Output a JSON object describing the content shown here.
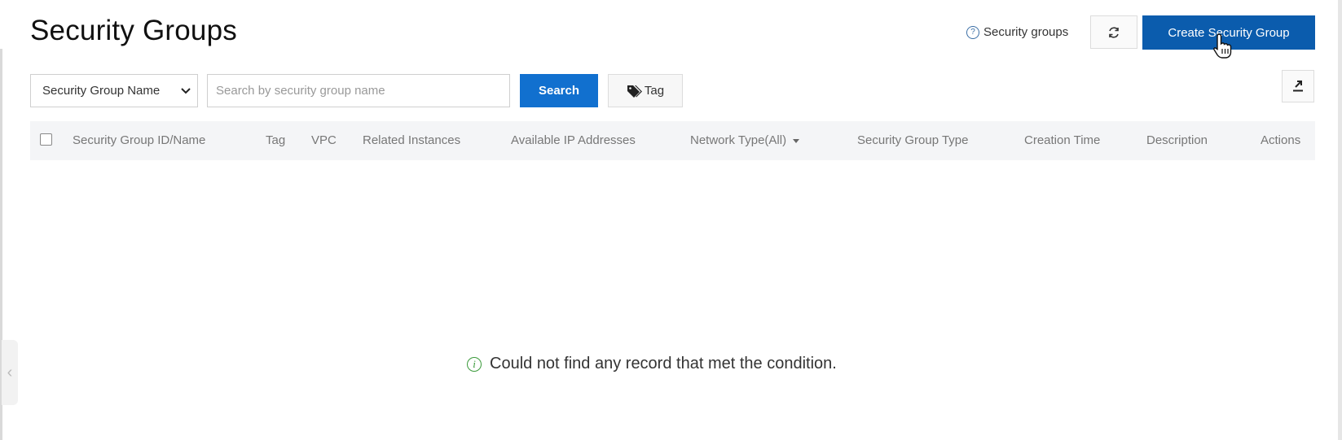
{
  "page": {
    "title": "Security Groups"
  },
  "header": {
    "help_link_label": "Security groups",
    "create_button_label": "Create Security Group"
  },
  "toolbar": {
    "filter_select_value": "Security Group Name",
    "search_placeholder": "Search by security group name",
    "search_button_label": "Search",
    "tag_button_label": "Tag"
  },
  "table": {
    "columns": [
      "Security Group ID/Name",
      "Tag",
      "VPC",
      "Related Instances",
      "Available IP Addresses",
      "Network Type(All)",
      "Security Group Type",
      "Creation Time",
      "Description",
      "Actions"
    ],
    "empty_message": "Could not find any record that met the condition."
  },
  "colors": {
    "primary_button": "#0b5cad",
    "search_button": "#1170cf",
    "header_bg": "#f4f5f7"
  },
  "icons": [
    "help-icon",
    "refresh-icon",
    "mouse-pointer-icon",
    "tag-icon",
    "export-icon",
    "info-icon",
    "chevron-down-icon",
    "chevron-left-icon"
  ]
}
